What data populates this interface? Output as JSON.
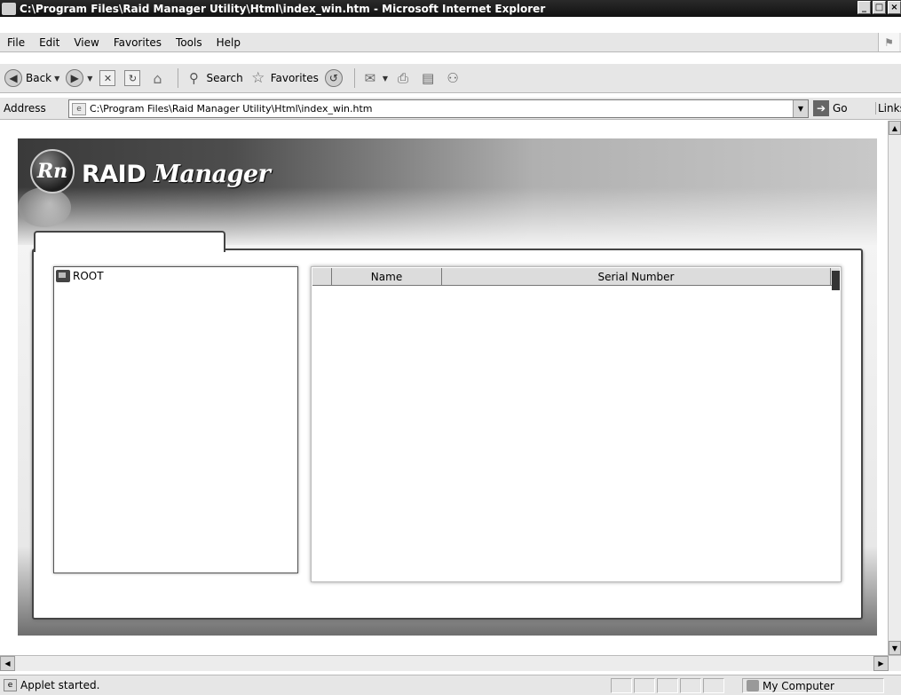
{
  "window": {
    "title": "C:\\Program Files\\Raid Manager Utility\\Html\\index_win.htm - Microsoft Internet Explorer",
    "minimize": "_",
    "maximize": "□",
    "close": "×"
  },
  "menu": {
    "items": [
      "File",
      "Edit",
      "View",
      "Favorites",
      "Tools",
      "Help"
    ]
  },
  "toolbar": {
    "back_label": "Back",
    "search_label": "Search",
    "favorites_label": "Favorites"
  },
  "address": {
    "label": "Address",
    "url": "C:\\Program Files\\Raid Manager Utility\\Html\\index_win.htm",
    "go_label": "Go",
    "links_label": "Links"
  },
  "applet": {
    "logo_badge": "Rn",
    "logo_raid": "RAID",
    "logo_manager": "Manager",
    "tree": {
      "root_label": "ROOT"
    },
    "list": {
      "columns": [
        "",
        "Name",
        "Serial Number"
      ]
    }
  },
  "status": {
    "text": "Applet started.",
    "zone": "My Computer"
  }
}
